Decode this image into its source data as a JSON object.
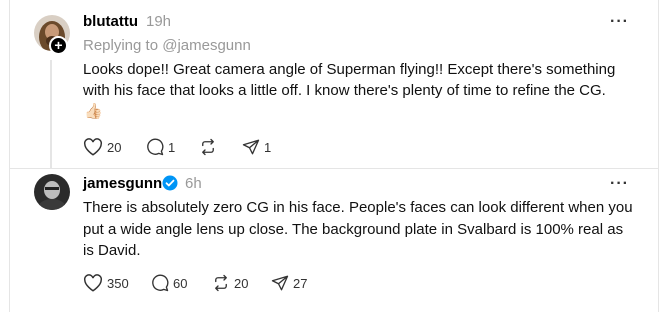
{
  "reply1": {
    "username": "blutattu",
    "timestamp": "19h",
    "replying_to": "Replying to @jamesgunn",
    "text_line1": "Looks dope!! Great camera angle of Superman flying!! Except there's something",
    "text_line2": "with his face that looks a little off. I know there's plenty of time to refine the CG.",
    "emoji": "👍🏻",
    "likes": "20",
    "comments": "1",
    "reposts": "",
    "shares": "1"
  },
  "reply2": {
    "username": "jamesgunn",
    "timestamp": "6h",
    "verified": true,
    "text_line1": "There is absolutely zero CG in his face. People's faces can look different when you",
    "text_line2": "put a wide angle lens up close. The background plate in Svalbard is 100% real as",
    "text_line3": "is David.",
    "likes": "350",
    "comments": "60",
    "reposts": "20",
    "shares": "27"
  },
  "colors": {
    "verified": "#0095f6",
    "muted": "#999999",
    "divider": "#e5e5e5"
  }
}
